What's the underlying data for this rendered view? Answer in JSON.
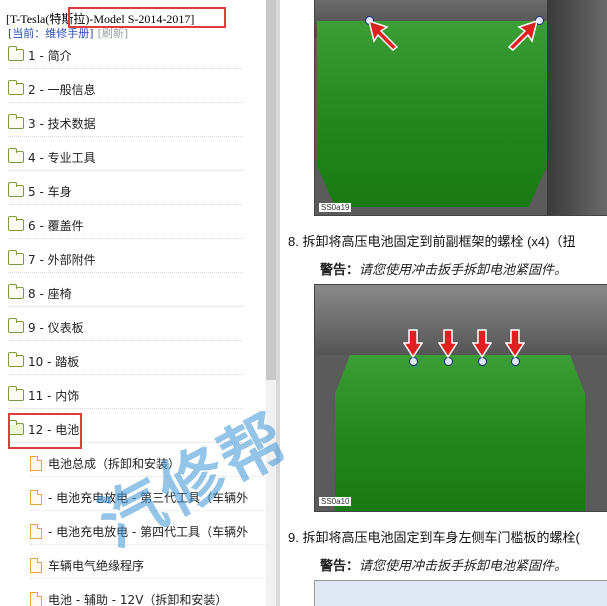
{
  "header": {
    "title": "[T-Tesla(特斯拉)-Model S-2014-2017]",
    "current_label": "[当前：维修手册]",
    "refresh_label": "[刷新]"
  },
  "tree": [
    {
      "label": "1 - 简介"
    },
    {
      "label": "2 - 一般信息"
    },
    {
      "label": "3 - 技术数据"
    },
    {
      "label": "4 - 专业工具"
    },
    {
      "label": "5 - 车身"
    },
    {
      "label": "6 - 覆盖件"
    },
    {
      "label": "7 - 外部附件"
    },
    {
      "label": "8 - 座椅"
    },
    {
      "label": "9 - 仪表板"
    },
    {
      "label": "10 - 踏板"
    },
    {
      "label": "11 - 内饰"
    },
    {
      "label": "12 - 电池"
    }
  ],
  "subitems": [
    {
      "label": "电池总成（拆卸和安装）"
    },
    {
      "label": "- 电池充电放电 - 第三代工具（车辆外"
    },
    {
      "label": "- 电池充电放电 - 第四代工具（车辆外"
    },
    {
      "label": "车辆电气绝缘程序"
    },
    {
      "label": "电池 - 辅助 - 12V（拆卸和安装）"
    }
  ],
  "document": {
    "fig1_label": "SS0a19",
    "step8": "8. 拆卸将高压电池固定到前副框架的螺栓 (x4)（扭",
    "warn_label": "警告：",
    "warn8": "请您使用冲击扳手拆卸电池紧固件。",
    "fig2_label": "SS0a10",
    "step9": "9. 拆卸将高压电池固定到车身左侧车门槛板的螺栓(",
    "warn9": "请您使用冲击扳手拆卸电池紧固件。",
    "watermark": "汽修帮"
  },
  "colors": {
    "highlight": "#e23b3b",
    "plate_green": "#2a8e22",
    "arrow_red": "#e02020",
    "watermark": "#3c96d7"
  }
}
